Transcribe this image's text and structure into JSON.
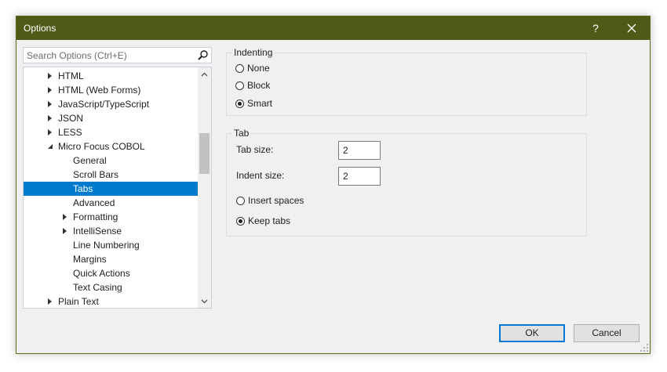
{
  "window": {
    "title": "Options",
    "help_label": "?",
    "title_bar_color": "#4f5a19"
  },
  "search": {
    "placeholder": "Search Options (Ctrl+E)"
  },
  "tree": {
    "items": [
      {
        "label": "HTML",
        "level": 0,
        "arrow": "collapsed"
      },
      {
        "label": "HTML (Web Forms)",
        "level": 0,
        "arrow": "collapsed"
      },
      {
        "label": "JavaScript/TypeScript",
        "level": 0,
        "arrow": "collapsed"
      },
      {
        "label": "JSON",
        "level": 0,
        "arrow": "collapsed"
      },
      {
        "label": "LESS",
        "level": 0,
        "arrow": "collapsed"
      },
      {
        "label": "Micro Focus COBOL",
        "level": 0,
        "arrow": "expanded"
      },
      {
        "label": "General",
        "level": 1,
        "arrow": "none"
      },
      {
        "label": "Scroll Bars",
        "level": 1,
        "arrow": "none"
      },
      {
        "label": "Tabs",
        "level": 1,
        "arrow": "none",
        "selected": true
      },
      {
        "label": "Advanced",
        "level": 1,
        "arrow": "none"
      },
      {
        "label": "Formatting",
        "level": 1,
        "arrow": "collapsed"
      },
      {
        "label": "IntelliSense",
        "level": 1,
        "arrow": "collapsed"
      },
      {
        "label": "Line Numbering",
        "level": 1,
        "arrow": "none"
      },
      {
        "label": "Margins",
        "level": 1,
        "arrow": "none"
      },
      {
        "label": "Quick Actions",
        "level": 1,
        "arrow": "none"
      },
      {
        "label": "Text Casing",
        "level": 1,
        "arrow": "none"
      },
      {
        "label": "Plain Text",
        "level": 0,
        "arrow": "collapsed"
      }
    ],
    "selection_color": "#007acc"
  },
  "indenting": {
    "legend": "Indenting",
    "options": [
      {
        "label": "None",
        "checked": false
      },
      {
        "label": "Block",
        "checked": false
      },
      {
        "label": "Smart",
        "checked": true
      }
    ]
  },
  "tab": {
    "legend": "Tab",
    "tab_size_label": "Tab size:",
    "tab_size_value": "2",
    "indent_size_label": "Indent size:",
    "indent_size_value": "2",
    "insert_spaces_label": "Insert spaces",
    "insert_spaces_checked": false,
    "keep_tabs_label": "Keep tabs",
    "keep_tabs_checked": true
  },
  "buttons": {
    "ok": "OK",
    "cancel": "Cancel",
    "accent": "#0078d7"
  }
}
